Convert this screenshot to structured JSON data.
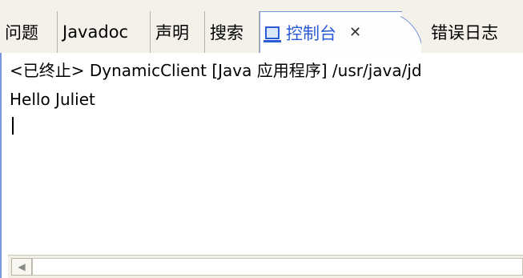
{
  "tabs": [
    {
      "label": "问题"
    },
    {
      "label": "Javadoc"
    },
    {
      "label": "声明"
    },
    {
      "label": "搜索"
    },
    {
      "label": "控制台",
      "icon": "console-icon",
      "close": "✕"
    },
    {
      "label": "错误日志"
    }
  ],
  "console": {
    "status_line": "<已终止> DynamicClient [Java 应用程序] /usr/java/jd",
    "output_line": "Hello Juliet"
  },
  "scrollbar": {
    "left_arrow": "◀"
  },
  "colors": {
    "active_tab": "#2a5bd6",
    "border": "#7a96df"
  }
}
